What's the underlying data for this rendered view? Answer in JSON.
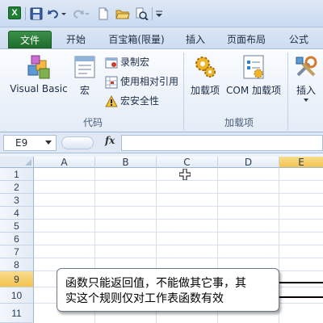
{
  "quick_access": {
    "icons": [
      "excel-logo-icon",
      "save-icon",
      "undo-icon",
      "redo-icon",
      "new-file-icon",
      "open-folder-icon",
      "print-preview-icon",
      "customize-toolbar-icon"
    ],
    "logo_text": "X"
  },
  "tabs": [
    {
      "label": "文件",
      "active": false,
      "style": "file"
    },
    {
      "label": "开始",
      "active": false
    },
    {
      "label": "百宝箱(限量)",
      "active": false
    },
    {
      "label": "插入",
      "active": false
    },
    {
      "label": "页面布局",
      "active": false
    },
    {
      "label": "公式",
      "active": false
    }
  ],
  "ribbon": {
    "code_group": {
      "label": "代码",
      "visual_basic": "Visual Basic",
      "macros": "宏",
      "record_macro": "录制宏",
      "relative_refs": "使用相对引用",
      "macro_security": "宏安全性"
    },
    "addins_group": {
      "label": "加载项",
      "addins": "加载项",
      "com_addins": "COM 加载项"
    },
    "insert_group": {
      "insert": "插入"
    }
  },
  "formula_bar": {
    "name_box": "E9",
    "fx_label": "fx",
    "formula": ""
  },
  "grid": {
    "columns": [
      "A",
      "B",
      "C",
      "D",
      "E"
    ],
    "selected_column": "E",
    "rows": [
      "1",
      "2",
      "3",
      "4",
      "5",
      "6",
      "7",
      "8",
      "9",
      "10",
      "11"
    ],
    "selected_row": "9"
  },
  "callout": {
    "line1": "函数只能返回值，不能做其它事，其",
    "line2": "实这个规则仅对工作表函数有效"
  },
  "colors": {
    "file_tab": "#1f6e2c",
    "header_selected": "#f3c34d",
    "ribbon_bg": "#e4ecf7"
  }
}
